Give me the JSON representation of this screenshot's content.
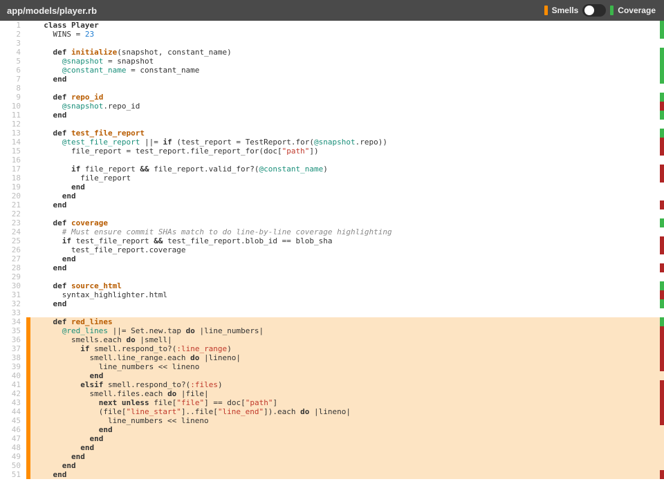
{
  "header": {
    "file_path": "app/models/player.rb",
    "smells_label": "Smells",
    "coverage_label": "Coverage",
    "toggle_state": "smells"
  },
  "colors": {
    "smell_swatch": "#ff8c00",
    "coverage_swatch": "#3cb64b",
    "coverage_hit": "#3cb64b",
    "coverage_miss": "#b02525",
    "smell_highlight": "#fde4c3"
  },
  "lines": [
    {
      "n": 1,
      "hl": false,
      "cov": "green",
      "tokens": [
        [
          "pln",
          "  "
        ],
        [
          "kw",
          "class"
        ],
        [
          "pln",
          " "
        ],
        [
          "cls",
          "Player"
        ]
      ]
    },
    {
      "n": 2,
      "hl": false,
      "cov": "green",
      "tokens": [
        [
          "pln",
          "    "
        ],
        [
          "const",
          "WINS"
        ],
        [
          "pln",
          " = "
        ],
        [
          "int",
          "23"
        ]
      ]
    },
    {
      "n": 3,
      "hl": false,
      "cov": null,
      "tokens": []
    },
    {
      "n": 4,
      "hl": false,
      "cov": "green",
      "tokens": [
        [
          "pln",
          "    "
        ],
        [
          "kw",
          "def"
        ],
        [
          "pln",
          " "
        ],
        [
          "def",
          "initialize"
        ],
        [
          "pln",
          "(snapshot, constant_name)"
        ]
      ]
    },
    {
      "n": 5,
      "hl": false,
      "cov": "green",
      "tokens": [
        [
          "pln",
          "      "
        ],
        [
          "ivar",
          "@snapshot"
        ],
        [
          "pln",
          " = snapshot"
        ]
      ]
    },
    {
      "n": 6,
      "hl": false,
      "cov": "green",
      "tokens": [
        [
          "pln",
          "      "
        ],
        [
          "ivar",
          "@constant_name"
        ],
        [
          "pln",
          " = constant_name"
        ]
      ]
    },
    {
      "n": 7,
      "hl": false,
      "cov": "green",
      "tokens": [
        [
          "pln",
          "    "
        ],
        [
          "kw",
          "end"
        ]
      ]
    },
    {
      "n": 8,
      "hl": false,
      "cov": null,
      "tokens": []
    },
    {
      "n": 9,
      "hl": false,
      "cov": "green",
      "tokens": [
        [
          "pln",
          "    "
        ],
        [
          "kw",
          "def"
        ],
        [
          "pln",
          " "
        ],
        [
          "def",
          "repo_id"
        ]
      ]
    },
    {
      "n": 10,
      "hl": false,
      "cov": "red",
      "tokens": [
        [
          "pln",
          "      "
        ],
        [
          "ivar",
          "@snapshot"
        ],
        [
          "pln",
          ".repo_id"
        ]
      ]
    },
    {
      "n": 11,
      "hl": false,
      "cov": "green",
      "tokens": [
        [
          "pln",
          "    "
        ],
        [
          "kw",
          "end"
        ]
      ]
    },
    {
      "n": 12,
      "hl": false,
      "cov": null,
      "tokens": []
    },
    {
      "n": 13,
      "hl": false,
      "cov": "green",
      "tokens": [
        [
          "pln",
          "    "
        ],
        [
          "kw",
          "def"
        ],
        [
          "pln",
          " "
        ],
        [
          "def",
          "test_file_report"
        ]
      ]
    },
    {
      "n": 14,
      "hl": false,
      "cov": "red",
      "tokens": [
        [
          "pln",
          "      "
        ],
        [
          "ivar",
          "@test_file_report"
        ],
        [
          "pln",
          " ||= "
        ],
        [
          "kw",
          "if"
        ],
        [
          "pln",
          " (test_report = "
        ],
        [
          "const",
          "TestReport"
        ],
        [
          "pln",
          ".for("
        ],
        [
          "ivar",
          "@snapshot"
        ],
        [
          "pln",
          ".repo))"
        ]
      ]
    },
    {
      "n": 15,
      "hl": false,
      "cov": "red",
      "tokens": [
        [
          "pln",
          "        file_report = test_report.file_report_for(doc["
        ],
        [
          "str",
          "\"path\""
        ],
        [
          "pln",
          "])"
        ]
      ]
    },
    {
      "n": 16,
      "hl": false,
      "cov": null,
      "tokens": []
    },
    {
      "n": 17,
      "hl": false,
      "cov": "red",
      "tokens": [
        [
          "pln",
          "        "
        ],
        [
          "kw",
          "if"
        ],
        [
          "pln",
          " file_report "
        ],
        [
          "kw",
          "&&"
        ],
        [
          "pln",
          " file_report.valid_for?("
        ],
        [
          "ivar",
          "@constant_name"
        ],
        [
          "pln",
          ")"
        ]
      ]
    },
    {
      "n": 18,
      "hl": false,
      "cov": "red",
      "tokens": [
        [
          "pln",
          "          file_report"
        ]
      ]
    },
    {
      "n": 19,
      "hl": false,
      "cov": null,
      "tokens": [
        [
          "pln",
          "        "
        ],
        [
          "kw",
          "end"
        ]
      ]
    },
    {
      "n": 20,
      "hl": false,
      "cov": null,
      "tokens": [
        [
          "pln",
          "      "
        ],
        [
          "kw",
          "end"
        ]
      ]
    },
    {
      "n": 21,
      "hl": false,
      "cov": "red",
      "tokens": [
        [
          "pln",
          "    "
        ],
        [
          "kw",
          "end"
        ]
      ]
    },
    {
      "n": 22,
      "hl": false,
      "cov": null,
      "tokens": []
    },
    {
      "n": 23,
      "hl": false,
      "cov": "green",
      "tokens": [
        [
          "pln",
          "    "
        ],
        [
          "kw",
          "def"
        ],
        [
          "pln",
          " "
        ],
        [
          "def",
          "coverage"
        ]
      ]
    },
    {
      "n": 24,
      "hl": false,
      "cov": null,
      "tokens": [
        [
          "pln",
          "      "
        ],
        [
          "cmt",
          "# Must ensure commit SHAs match to do line-by-line coverage highlighting"
        ]
      ]
    },
    {
      "n": 25,
      "hl": false,
      "cov": "red",
      "tokens": [
        [
          "pln",
          "      "
        ],
        [
          "kw",
          "if"
        ],
        [
          "pln",
          " test_file_report "
        ],
        [
          "kw",
          "&&"
        ],
        [
          "pln",
          " test_file_report.blob_id == blob_sha"
        ]
      ]
    },
    {
      "n": 26,
      "hl": false,
      "cov": "red",
      "tokens": [
        [
          "pln",
          "        test_file_report.coverage"
        ]
      ]
    },
    {
      "n": 27,
      "hl": false,
      "cov": null,
      "tokens": [
        [
          "pln",
          "      "
        ],
        [
          "kw",
          "end"
        ]
      ]
    },
    {
      "n": 28,
      "hl": false,
      "cov": "red",
      "tokens": [
        [
          "pln",
          "    "
        ],
        [
          "kw",
          "end"
        ]
      ]
    },
    {
      "n": 29,
      "hl": false,
      "cov": null,
      "tokens": []
    },
    {
      "n": 30,
      "hl": false,
      "cov": "green",
      "tokens": [
        [
          "pln",
          "    "
        ],
        [
          "kw",
          "def"
        ],
        [
          "pln",
          " "
        ],
        [
          "def",
          "source_html"
        ]
      ]
    },
    {
      "n": 31,
      "hl": false,
      "cov": "red",
      "tokens": [
        [
          "pln",
          "      syntax_highlighter.html"
        ]
      ]
    },
    {
      "n": 32,
      "hl": false,
      "cov": "green",
      "tokens": [
        [
          "pln",
          "    "
        ],
        [
          "kw",
          "end"
        ]
      ]
    },
    {
      "n": 33,
      "hl": false,
      "cov": null,
      "tokens": []
    },
    {
      "n": 34,
      "hl": true,
      "cov": "green",
      "tokens": [
        [
          "pln",
          "    "
        ],
        [
          "kw",
          "def"
        ],
        [
          "pln",
          " "
        ],
        [
          "def",
          "red_lines"
        ]
      ]
    },
    {
      "n": 35,
      "hl": true,
      "cov": "red",
      "tokens": [
        [
          "pln",
          "      "
        ],
        [
          "ivar",
          "@red_lines"
        ],
        [
          "pln",
          " ||= "
        ],
        [
          "const",
          "Set"
        ],
        [
          "pln",
          ".new.tap "
        ],
        [
          "kw",
          "do"
        ],
        [
          "pln",
          " |line_numbers|"
        ]
      ]
    },
    {
      "n": 36,
      "hl": true,
      "cov": "red",
      "tokens": [
        [
          "pln",
          "        smells.each "
        ],
        [
          "kw",
          "do"
        ],
        [
          "pln",
          " |smell|"
        ]
      ]
    },
    {
      "n": 37,
      "hl": true,
      "cov": "red",
      "tokens": [
        [
          "pln",
          "          "
        ],
        [
          "kw",
          "if"
        ],
        [
          "pln",
          " smell.respond_to?("
        ],
        [
          "sym",
          ":line_range"
        ],
        [
          "pln",
          ")"
        ]
      ]
    },
    {
      "n": 38,
      "hl": true,
      "cov": "red",
      "tokens": [
        [
          "pln",
          "            smell.line_range.each "
        ],
        [
          "kw",
          "do"
        ],
        [
          "pln",
          " |lineno|"
        ]
      ]
    },
    {
      "n": 39,
      "hl": true,
      "cov": "red",
      "tokens": [
        [
          "pln",
          "              line_numbers << lineno"
        ]
      ]
    },
    {
      "n": 40,
      "hl": true,
      "cov": null,
      "tokens": [
        [
          "pln",
          "            "
        ],
        [
          "kw",
          "end"
        ]
      ]
    },
    {
      "n": 41,
      "hl": true,
      "cov": "red",
      "tokens": [
        [
          "pln",
          "          "
        ],
        [
          "kw",
          "elsif"
        ],
        [
          "pln",
          " smell.respond_to?("
        ],
        [
          "sym",
          ":files"
        ],
        [
          "pln",
          ")"
        ]
      ]
    },
    {
      "n": 42,
      "hl": true,
      "cov": "red",
      "tokens": [
        [
          "pln",
          "            smell.files.each "
        ],
        [
          "kw",
          "do"
        ],
        [
          "pln",
          " |file|"
        ]
      ]
    },
    {
      "n": 43,
      "hl": true,
      "cov": "red",
      "tokens": [
        [
          "pln",
          "              "
        ],
        [
          "kw",
          "next"
        ],
        [
          "pln",
          " "
        ],
        [
          "kw",
          "unless"
        ],
        [
          "pln",
          " file["
        ],
        [
          "str",
          "\"file\""
        ],
        [
          "pln",
          "] == doc["
        ],
        [
          "str",
          "\"path\""
        ],
        [
          "pln",
          "]"
        ]
      ]
    },
    {
      "n": 44,
      "hl": true,
      "cov": "red",
      "tokens": [
        [
          "pln",
          "              (file["
        ],
        [
          "str",
          "\"line_start\""
        ],
        [
          "pln",
          "]..file["
        ],
        [
          "str",
          "\"line_end\""
        ],
        [
          "pln",
          "]).each "
        ],
        [
          "kw",
          "do"
        ],
        [
          "pln",
          " |lineno|"
        ]
      ]
    },
    {
      "n": 45,
      "hl": true,
      "cov": "red",
      "tokens": [
        [
          "pln",
          "                line_numbers << lineno"
        ]
      ]
    },
    {
      "n": 46,
      "hl": true,
      "cov": null,
      "tokens": [
        [
          "pln",
          "              "
        ],
        [
          "kw",
          "end"
        ]
      ]
    },
    {
      "n": 47,
      "hl": true,
      "cov": null,
      "tokens": [
        [
          "pln",
          "            "
        ],
        [
          "kw",
          "end"
        ]
      ]
    },
    {
      "n": 48,
      "hl": true,
      "cov": null,
      "tokens": [
        [
          "pln",
          "          "
        ],
        [
          "kw",
          "end"
        ]
      ]
    },
    {
      "n": 49,
      "hl": true,
      "cov": null,
      "tokens": [
        [
          "pln",
          "        "
        ],
        [
          "kw",
          "end"
        ]
      ]
    },
    {
      "n": 50,
      "hl": true,
      "cov": null,
      "tokens": [
        [
          "pln",
          "      "
        ],
        [
          "kw",
          "end"
        ]
      ]
    },
    {
      "n": 51,
      "hl": true,
      "cov": "red",
      "tokens": [
        [
          "pln",
          "    "
        ],
        [
          "kw",
          "end"
        ]
      ]
    }
  ]
}
